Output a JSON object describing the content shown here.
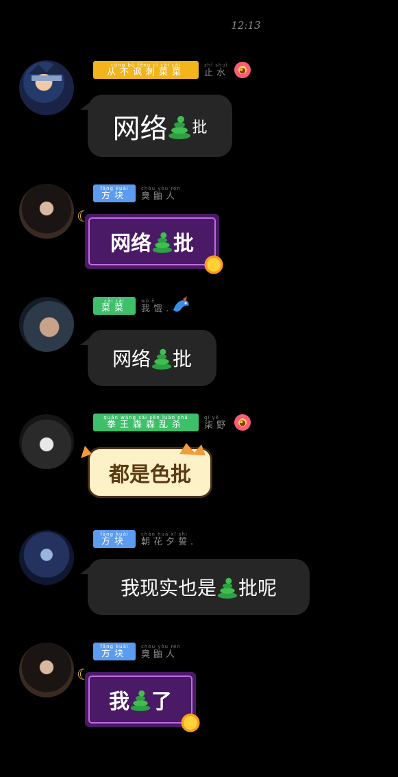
{
  "status_time": "12:13",
  "messages": [
    {
      "tag": {
        "pinyin": "cóng bù fěng cì cài cài",
        "hanzi": "从不讽刺菜菜",
        "color": "#f2b51c"
      },
      "nick": {
        "pinyin": "zhǐ shuǐ",
        "hanzi": "止水"
      },
      "badge": "flower-icon",
      "text_before": "网络",
      "text_after": "批",
      "bubble_style": "dark"
    },
    {
      "tag": {
        "pinyin": "fāng kuài",
        "hanzi": "方块",
        "color": "#5b9cf0"
      },
      "nick": {
        "pinyin": "chòu yòu rén",
        "hanzi": "臭鼬人"
      },
      "badge": "",
      "text_before": "网络",
      "text_after": "批",
      "bubble_style": "purple"
    },
    {
      "tag": {
        "pinyin": "cài cài",
        "hanzi": "菜菜",
        "color": "#3ebf6a"
      },
      "nick": {
        "pinyin": "wǒ è",
        "hanzi": "我饿."
      },
      "badge": "dragon-icon",
      "text_before": "网络",
      "text_after": "批",
      "bubble_style": "dark"
    },
    {
      "tag": {
        "pinyin": "quán wáng sài sēn luàn shā",
        "hanzi": "拳王森森乱杀",
        "color": "#3ebf6a"
      },
      "nick": {
        "pinyin": "qí yě",
        "hanzi": "柒野"
      },
      "badge": "flower-icon",
      "text_before": "都是色批",
      "text_after": "",
      "bubble_style": "cat"
    },
    {
      "tag": {
        "pinyin": "fāng kuài",
        "hanzi": "方块",
        "color": "#5b9cf0"
      },
      "nick": {
        "pinyin": "cháo huā xī shì",
        "hanzi": "朝花夕誓."
      },
      "badge": "",
      "text_before": "我现实也是",
      "text_after": "批呢",
      "bubble_style": "dark"
    },
    {
      "tag": {
        "pinyin": "fāng kuài",
        "hanzi": "方块",
        "color": "#5b9cf0"
      },
      "nick": {
        "pinyin": "chòu yòu rén",
        "hanzi": "臭鼬人"
      },
      "badge": "",
      "text_before": "我",
      "text_after": "了",
      "bubble_style": "purple"
    }
  ],
  "colors": {
    "bubble": "#262626",
    "purple_frame": "#4a1a66",
    "purple_border": "#c46be0",
    "cat_bubble": "#fdf1c8"
  }
}
